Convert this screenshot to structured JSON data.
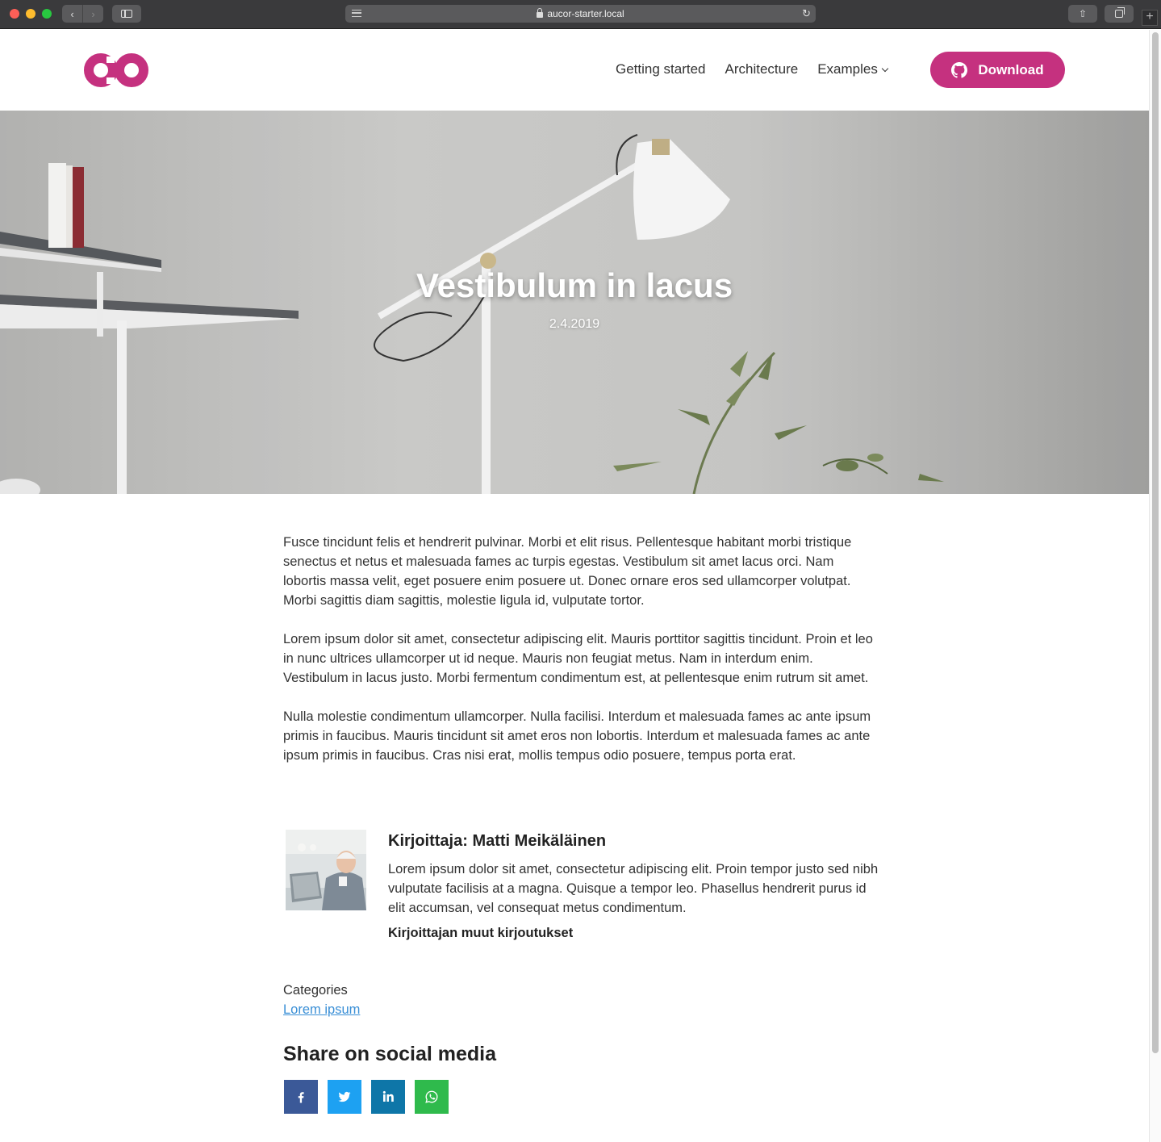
{
  "browser": {
    "url": "aucor-starter.local"
  },
  "header": {
    "nav": [
      {
        "label": "Getting started"
      },
      {
        "label": "Architecture"
      },
      {
        "label": "Examples"
      }
    ],
    "download_label": "Download",
    "brand_color": "#c5317f"
  },
  "hero": {
    "title": "Vestibulum in lacus",
    "date": "2.4.2019"
  },
  "article": {
    "paragraphs": [
      "Fusce tincidunt felis et hendrerit pulvinar. Morbi et elit risus. Pellentesque habitant morbi tristique senectus et netus et malesuada fames ac turpis egestas. Vestibulum sit amet lacus orci. Nam lobortis massa velit, eget posuere enim posuere ut. Donec ornare eros sed ullamcorper volutpat. Morbi sagittis diam sagittis, molestie ligula id, vulputate tortor.",
      "Lorem ipsum dolor sit amet, consectetur adipiscing elit. Mauris porttitor sagittis tincidunt. Proin et leo in nunc ultrices ullamcorper ut id neque. Mauris non feugiat metus. Nam in interdum enim. Vestibulum in lacus justo. Morbi fermentum condimentum est, at pellentesque enim rutrum sit amet.",
      "Nulla molestie condimentum ullamcorper. Nulla facilisi. Interdum et malesuada fames ac ante ipsum primis in faucibus. Mauris tincidunt sit amet eros non lobortis. Interdum et malesuada fames ac ante ipsum primis in faucibus. Cras nisi erat, mollis tempus odio posuere, tempus porta erat."
    ]
  },
  "author": {
    "name": "Kirjoittaja: Matti Meikäläinen",
    "bio": "Lorem ipsum dolor sit amet, consectetur adipiscing elit. Proin tempor justo sed nibh vulputate facilisis at a magna. Quisque a tempor leo. Phasellus hendrerit purus id elit accumsan, vel consequat metus condimentum.",
    "more_link": "Kirjoittajan muut kirjoutukset"
  },
  "categories": {
    "label": "Categories",
    "items": [
      "Lorem ipsum"
    ]
  },
  "share": {
    "title": "Share on social media",
    "buttons": [
      {
        "icon": "facebook-icon",
        "color": "#3b5998"
      },
      {
        "icon": "twitter-icon",
        "color": "#1da1f2"
      },
      {
        "icon": "linkedin-icon",
        "color": "#0e76a8"
      },
      {
        "icon": "whatsapp-icon",
        "color": "#2fba4c"
      }
    ]
  }
}
